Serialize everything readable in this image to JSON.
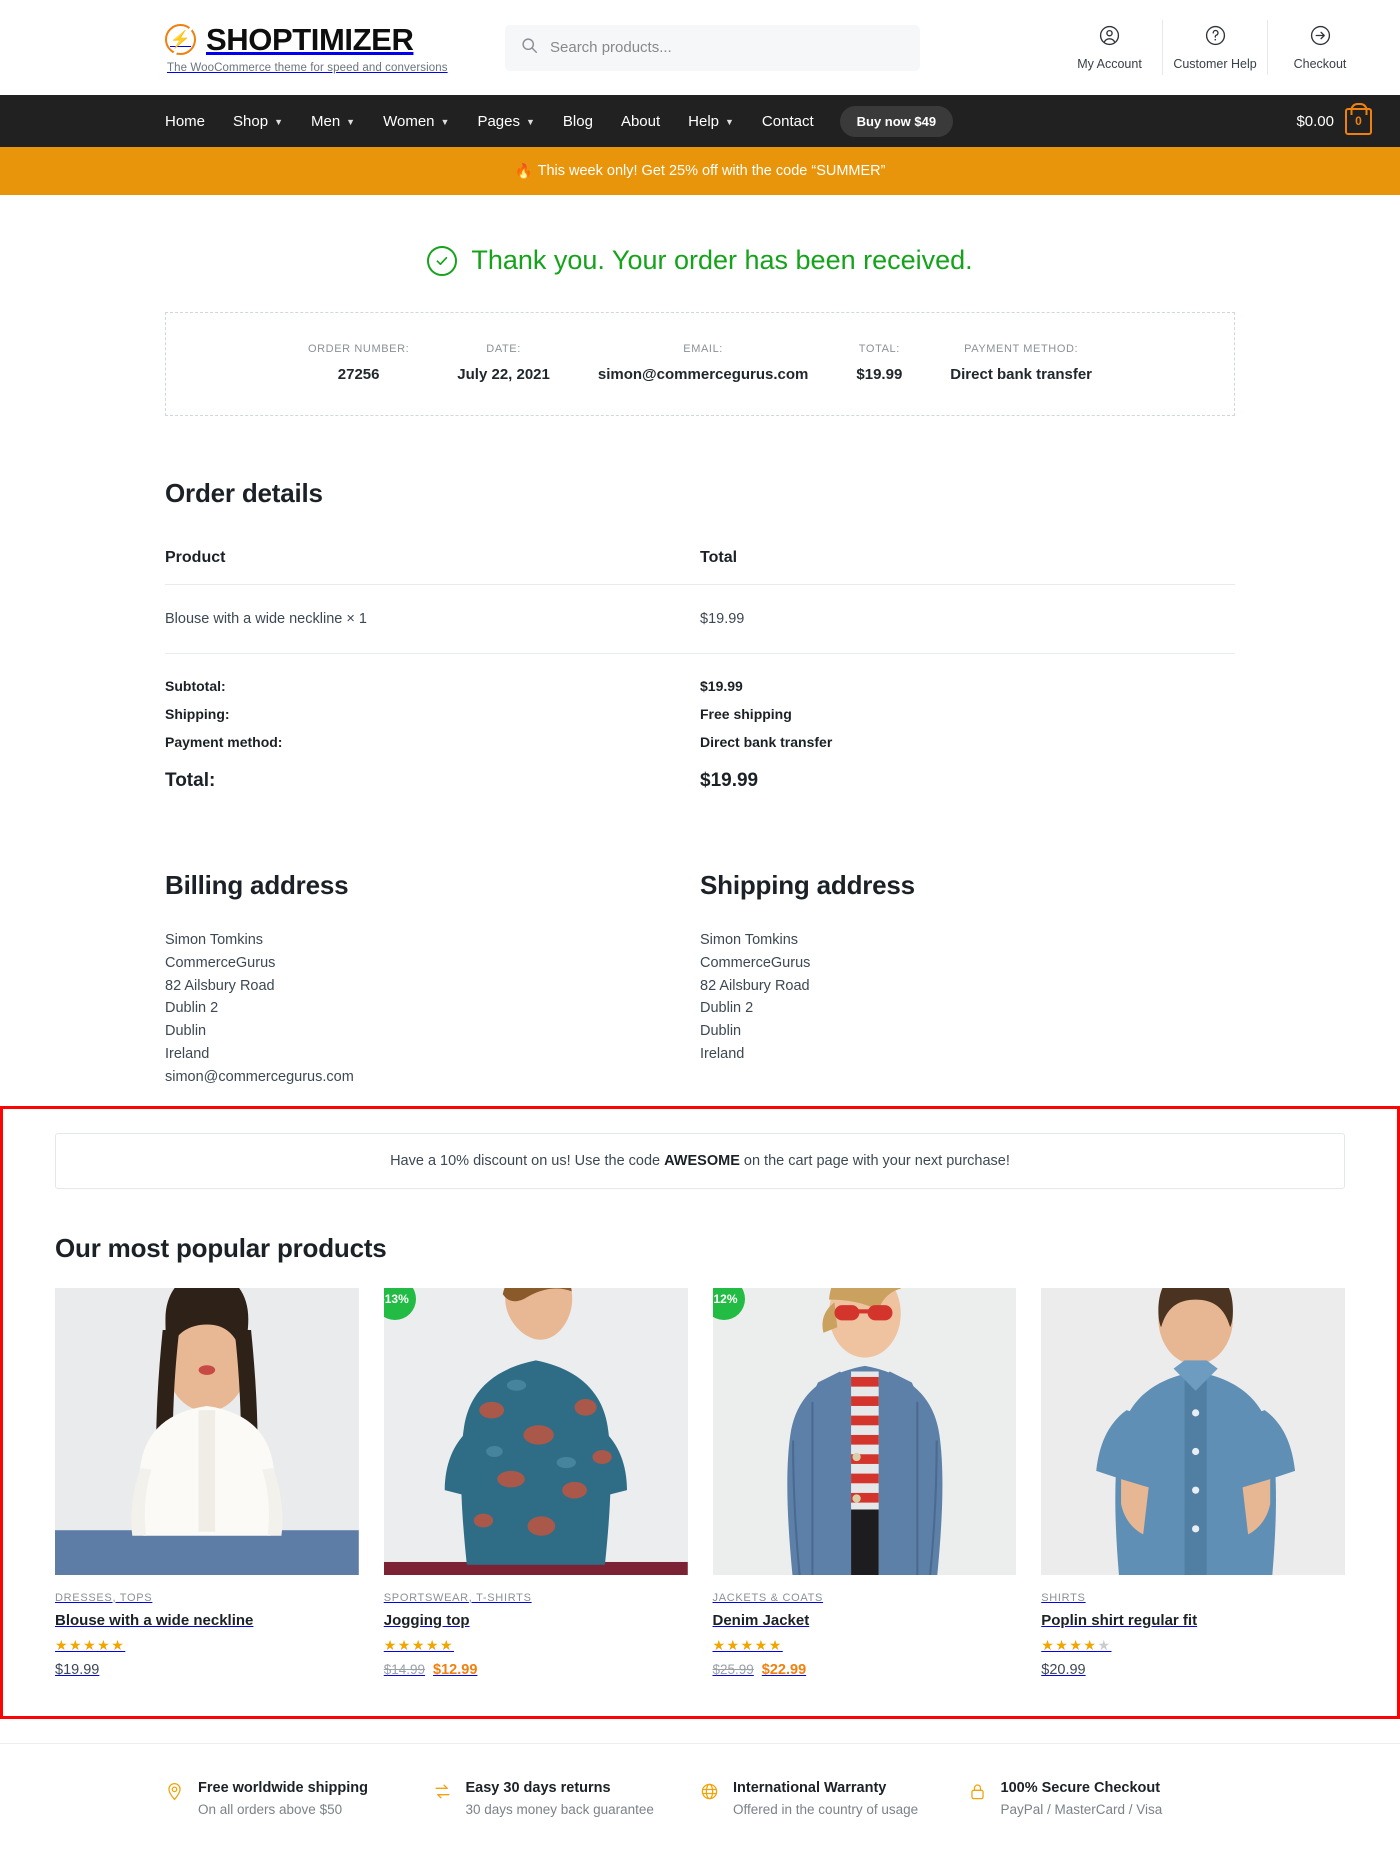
{
  "header": {
    "brand_name": "SHOPTIMIZER",
    "brand_tagline": "The WooCommerce theme for speed and conversions",
    "search_placeholder": "Search products...",
    "actions": [
      {
        "label": "My Account",
        "icon": "user-circle-icon"
      },
      {
        "label": "Customer Help",
        "icon": "question-circle-icon"
      },
      {
        "label": "Checkout",
        "icon": "arrow-right-circle-icon"
      }
    ]
  },
  "nav": {
    "items": [
      {
        "label": "Home",
        "has_dropdown": false
      },
      {
        "label": "Shop",
        "has_dropdown": true
      },
      {
        "label": "Men",
        "has_dropdown": true
      },
      {
        "label": "Women",
        "has_dropdown": true
      },
      {
        "label": "Pages",
        "has_dropdown": true
      },
      {
        "label": "Blog",
        "has_dropdown": false
      },
      {
        "label": "About",
        "has_dropdown": false
      },
      {
        "label": "Help",
        "has_dropdown": true
      },
      {
        "label": "Contact",
        "has_dropdown": false
      }
    ],
    "buy_now_label": "Buy now $49",
    "cart_total": "$0.00",
    "cart_count": "0"
  },
  "promo": {
    "flame": "🔥",
    "text": "This week only! Get 25% off with the code “SUMMER”",
    "background": "#e8950c"
  },
  "confirmation": {
    "message": "Thank you. Your order has been received.",
    "color": "#15a31b"
  },
  "order_summary": [
    {
      "label": "ORDER NUMBER:",
      "value": "27256"
    },
    {
      "label": "DATE:",
      "value": "July 22, 2021"
    },
    {
      "label": "EMAIL:",
      "value": "simon@commercegurus.com"
    },
    {
      "label": "TOTAL:",
      "value": "$19.99"
    },
    {
      "label": "PAYMENT METHOD:",
      "value": "Direct bank transfer"
    }
  ],
  "order_details": {
    "title": "Order details",
    "columns": [
      "Product",
      "Total"
    ],
    "items": [
      {
        "product": "Blouse with a wide neckline × 1",
        "total": "$19.99"
      }
    ],
    "totals": [
      {
        "label": "Subtotal:",
        "value": "$19.99"
      },
      {
        "label": "Shipping:",
        "value": "Free shipping"
      },
      {
        "label": "Payment method:",
        "value": "Direct bank transfer"
      }
    ],
    "grand_total": {
      "label": "Total:",
      "value": "$19.99"
    }
  },
  "billing": {
    "title": "Billing address",
    "lines": [
      "Simon Tomkins",
      "CommerceGurus",
      "82 Ailsbury Road",
      "Dublin 2",
      "Dublin",
      "Ireland",
      "simon@commercegurus.com"
    ]
  },
  "shipping": {
    "title": "Shipping address",
    "lines": [
      "Simon Tomkins",
      "CommerceGurus",
      "82 Ailsbury Road",
      "Dublin 2",
      "Dublin",
      "Ireland"
    ]
  },
  "discount_notice": {
    "prefix": "Have a 10% discount on us! Use the code ",
    "code": "AWESOME",
    "suffix": " on the cart page with your next purchase!"
  },
  "popular": {
    "title": "Our most popular products",
    "products": [
      {
        "badge": null,
        "category": "DRESSES, TOPS",
        "name": "Blouse with a wide neckline",
        "stars_filled": 5,
        "stars_total": 5,
        "old_price": null,
        "price": "$19.99",
        "on_sale": false,
        "image": "woman-white-blouse"
      },
      {
        "badge": "-13%",
        "category": "SPORTSWEAR, T-SHIRTS",
        "name": "Jogging top",
        "stars_filled": 5,
        "stars_total": 5,
        "old_price": "$14.99",
        "price": "$12.99",
        "on_sale": true,
        "image": "man-floral-tshirt"
      },
      {
        "badge": "-12%",
        "category": "JACKETS & COATS",
        "name": "Denim Jacket",
        "stars_filled": 5,
        "stars_total": 5,
        "old_price": "$25.99",
        "price": "$22.99",
        "on_sale": true,
        "image": "woman-denim-jacket"
      },
      {
        "badge": null,
        "category": "SHIRTS",
        "name": "Poplin shirt regular fit",
        "stars_filled": 4,
        "stars_total": 5,
        "old_price": null,
        "price": "$20.99",
        "on_sale": false,
        "image": "man-blue-shirt"
      }
    ],
    "badge_color": "#22bb44",
    "highlight_border_color": "#fb0404"
  },
  "footer_features": [
    {
      "icon": "location-pin-icon",
      "title": "Free worldwide shipping",
      "sub": "On all orders above $50"
    },
    {
      "icon": "return-arrows-icon",
      "title": "Easy 30 days returns",
      "sub": "30 days money back guarantee"
    },
    {
      "icon": "globe-icon",
      "title": "International Warranty",
      "sub": "Offered in the country of usage"
    },
    {
      "icon": "lock-icon",
      "title": "100% Secure Checkout",
      "sub": "PayPal / MasterCard / Visa"
    }
  ],
  "accent_color": "#f0810f"
}
